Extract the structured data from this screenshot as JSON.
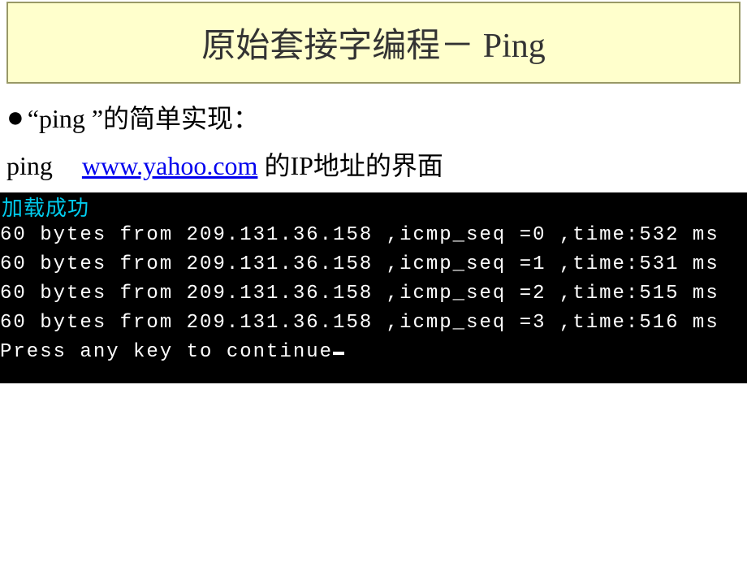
{
  "title": "原始套接字编程－ Ping",
  "bullet_text": "“ping ”的简单实现：",
  "subline": {
    "prefix": "ping",
    "link": "www.yahoo.com",
    "suffix": "的IP地址的界面"
  },
  "terminal": {
    "status": "加载成功",
    "lines": [
      "60 bytes from 209.131.36.158 ,icmp_seq =0 ,time:532 ms",
      "60 bytes from 209.131.36.158 ,icmp_seq =1 ,time:531 ms",
      "60 bytes from 209.131.36.158 ,icmp_seq =2 ,time:515 ms",
      "60 bytes from 209.131.36.158 ,icmp_seq =3 ,time:516 ms"
    ],
    "prompt": "Press any key to continue"
  }
}
